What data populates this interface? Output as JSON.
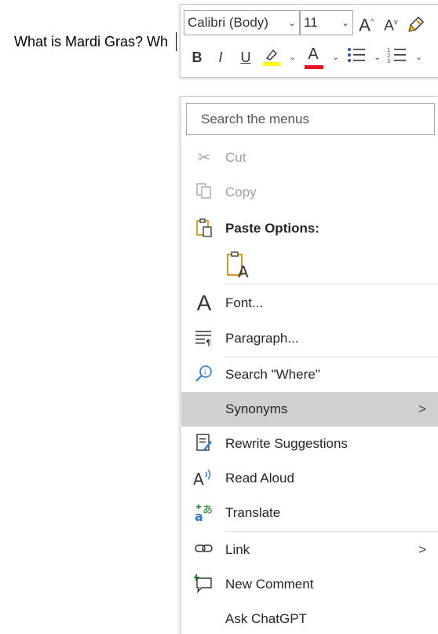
{
  "document": {
    "text": "What is Mardi Gras? Wh"
  },
  "mini_toolbar": {
    "font_name": "Calibri (Body)",
    "font_size": "11",
    "grow_font_label": "A",
    "shrink_font_label": "A",
    "bold_label": "B",
    "italic_label": "I",
    "underline_label": "U",
    "font_color_label": "A",
    "highlight_color": "#FFFF00",
    "font_color": "#E81123"
  },
  "context_menu": {
    "search_placeholder": "Search the menus",
    "items": {
      "cut": "Cut",
      "copy": "Copy",
      "paste_options": "Paste Options:",
      "font": "Font...",
      "paragraph": "Paragraph...",
      "search": "Search \"Where\"",
      "synonyms": "Synonyms",
      "rewrite": "Rewrite Suggestions",
      "read_aloud": "Read Aloud",
      "translate": "Translate",
      "link": "Link",
      "new_comment": "New Comment",
      "ask_chatgpt": "Ask ChatGPT"
    },
    "submenu_arrow": ">",
    "highlighted_item": "Synonyms"
  }
}
